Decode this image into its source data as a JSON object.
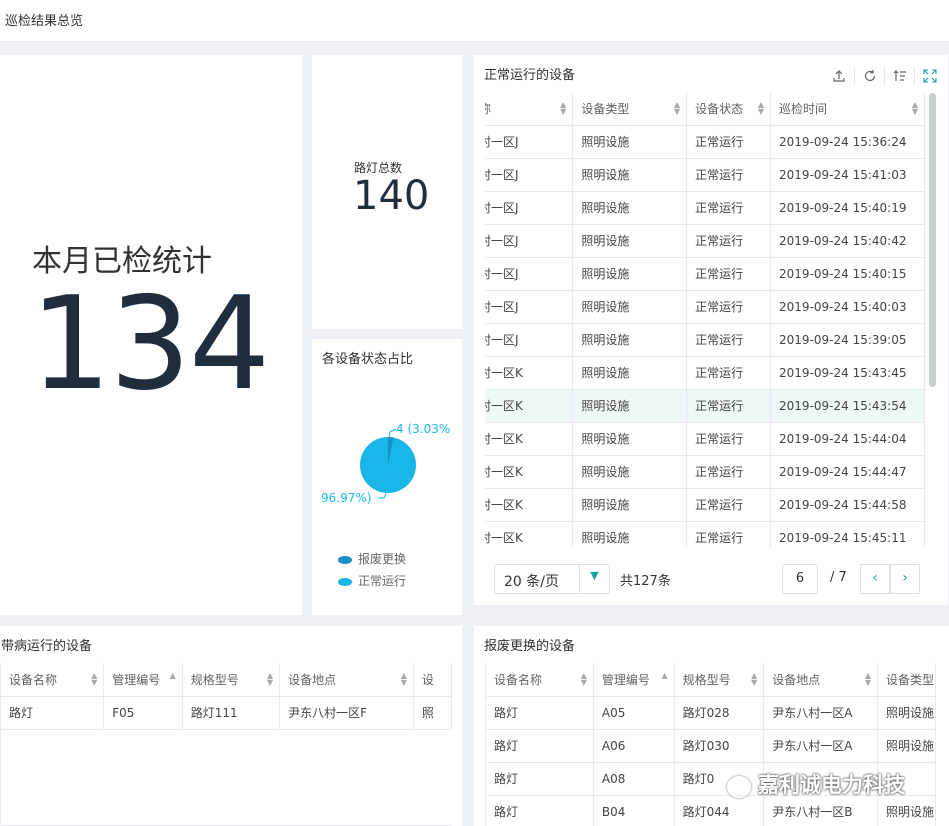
{
  "header": {
    "title": "巡检结果总览"
  },
  "monthly": {
    "label": "本月已检统计",
    "value": "134"
  },
  "lamps": {
    "label": "路灯总数",
    "value": "140"
  },
  "status_pie": {
    "title": "各设备状态占比",
    "label_small": "4 (3.03%",
    "label_large": "96.97%)",
    "legend": [
      "报废更换",
      "正常运行"
    ],
    "colors": {
      "scrap": "#1a8ec7",
      "normal": "#1ab6e8"
    }
  },
  "normal_devices": {
    "title": "正常运行的设备",
    "icons": [
      "export-icon",
      "refresh-icon",
      "sort-icon",
      "fullscreen-icon"
    ],
    "columns": [
      "称",
      "设备类型",
      "设备状态",
      "巡检时间"
    ],
    "rows": [
      [
        "村一区J",
        "照明设施",
        "正常运行",
        "2019-09-24 15:36:24"
      ],
      [
        "村一区J",
        "照明设施",
        "正常运行",
        "2019-09-24 15:41:03"
      ],
      [
        "村一区J",
        "照明设施",
        "正常运行",
        "2019-09-24 15:40:19"
      ],
      [
        "村一区J",
        "照明设施",
        "正常运行",
        "2019-09-24 15:40:42"
      ],
      [
        "村一区J",
        "照明设施",
        "正常运行",
        "2019-09-24 15:40:15"
      ],
      [
        "村一区J",
        "照明设施",
        "正常运行",
        "2019-09-24 15:40:03"
      ],
      [
        "村一区J",
        "照明设施",
        "正常运行",
        "2019-09-24 15:39:05"
      ],
      [
        "村一区K",
        "照明设施",
        "正常运行",
        "2019-09-24 15:43:45"
      ],
      [
        "村一区K",
        "照明设施",
        "正常运行",
        "2019-09-24 15:43:54"
      ],
      [
        "村一区K",
        "照明设施",
        "正常运行",
        "2019-09-24 15:44:04"
      ],
      [
        "村一区K",
        "照明设施",
        "正常运行",
        "2019-09-24 15:44:47"
      ],
      [
        "村一区K",
        "照明设施",
        "正常运行",
        "2019-09-24 15:44:58"
      ],
      [
        "村一区K",
        "照明设施",
        "正常运行",
        "2019-09-24 15:45:11"
      ]
    ],
    "pager": {
      "page_size": "20 条/页",
      "total": "共127条",
      "page": "6",
      "pages": "/ 7"
    }
  },
  "sick_devices": {
    "title": "带病运行的设备",
    "columns": [
      "设备名称",
      "管理编号",
      "规格型号",
      "设备地点",
      "设"
    ],
    "rows": [
      [
        "路灯",
        "F05",
        "路灯111",
        "尹东八村一区F",
        "照"
      ]
    ]
  },
  "scrap_devices": {
    "title": "报废更换的设备",
    "columns": [
      "设备名称",
      "管理编号",
      "规格型号",
      "设备地点",
      "设备类型"
    ],
    "rows": [
      [
        "路灯",
        "A05",
        "路灯028",
        "尹东八村一区A",
        "照明设施"
      ],
      [
        "路灯",
        "A06",
        "路灯030",
        "尹东八村一区A",
        "照明设施"
      ],
      [
        "路灯",
        "A08",
        "路灯0",
        "",
        ""
      ],
      [
        "路灯",
        "B04",
        "路灯044",
        "尹东八村一区B",
        "照明设施"
      ]
    ]
  },
  "watermark": "嘉利诚电力科技"
}
